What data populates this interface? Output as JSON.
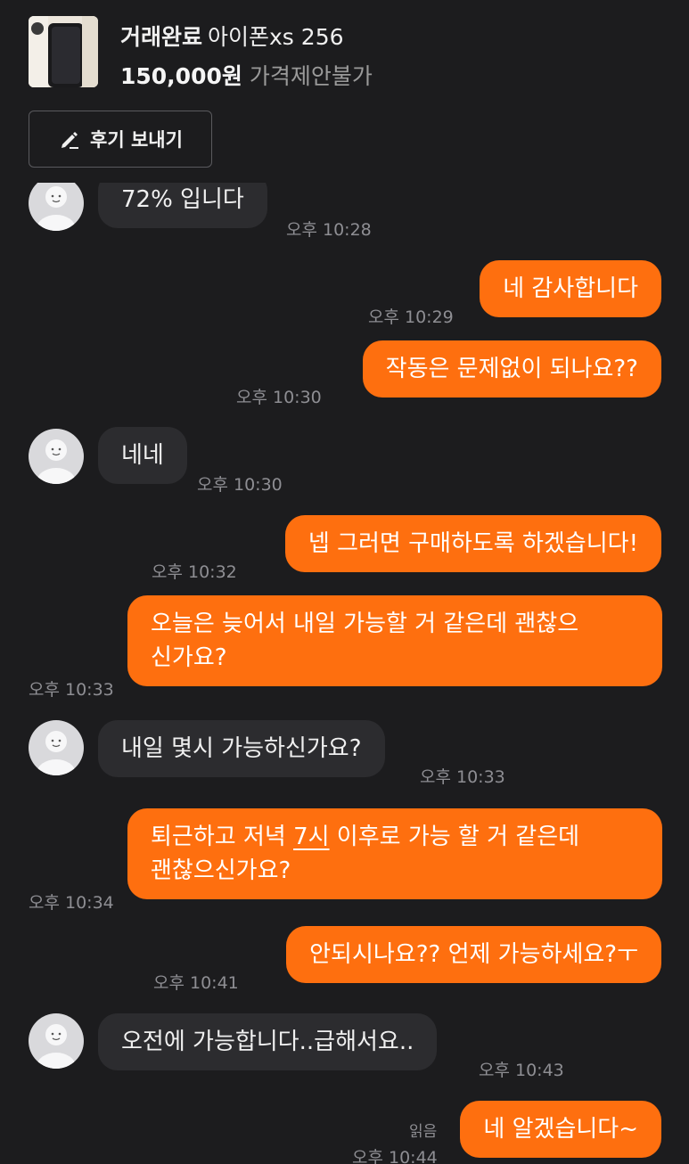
{
  "product": {
    "status": "거래완료",
    "name": "아이폰xs 256",
    "price": "150,000원",
    "negotiation": "가격제안불가",
    "review_button": "후기 보내기"
  },
  "messages": [
    {
      "from": "seller",
      "text": "72% 입니다",
      "time": "오후 10:28"
    },
    {
      "from": "me",
      "text": "네 감사합니다",
      "time": "오후 10:29"
    },
    {
      "from": "me",
      "text": "작동은 문제없이 되나요??",
      "time": "오후 10:30"
    },
    {
      "from": "seller",
      "text": "네네",
      "time": "오후 10:30"
    },
    {
      "from": "me",
      "text": "넵 그러면 구매하도록 하겠습니다!",
      "time": "오후 10:32"
    },
    {
      "from": "me",
      "text_line1": "오늘은 늦어서 내일 가능할 거 같은데 괜찮으",
      "text_line2": "신가요?",
      "time": "오후 10:33"
    },
    {
      "from": "seller",
      "text": "내일 몇시 가능하신가요?",
      "time": "오후 10:33"
    },
    {
      "from": "me",
      "text_pre": "퇴근하고 저녁 ",
      "text_link": "7시",
      "text_post": " 이후로 가능 할 거 같은데",
      "text_line2": "괜찮으신가요?",
      "time": "오후 10:34"
    },
    {
      "from": "me",
      "text": "안되시나요?? 언제 가능하세요?ㅜ",
      "time": "오후 10:41"
    },
    {
      "from": "seller",
      "text": "오전에 가능합니다..급해서요..",
      "time": "오후 10:43"
    },
    {
      "from": "me",
      "text": "네 알겠습니다~",
      "time": "오후 10:44",
      "read": "읽음"
    }
  ]
}
